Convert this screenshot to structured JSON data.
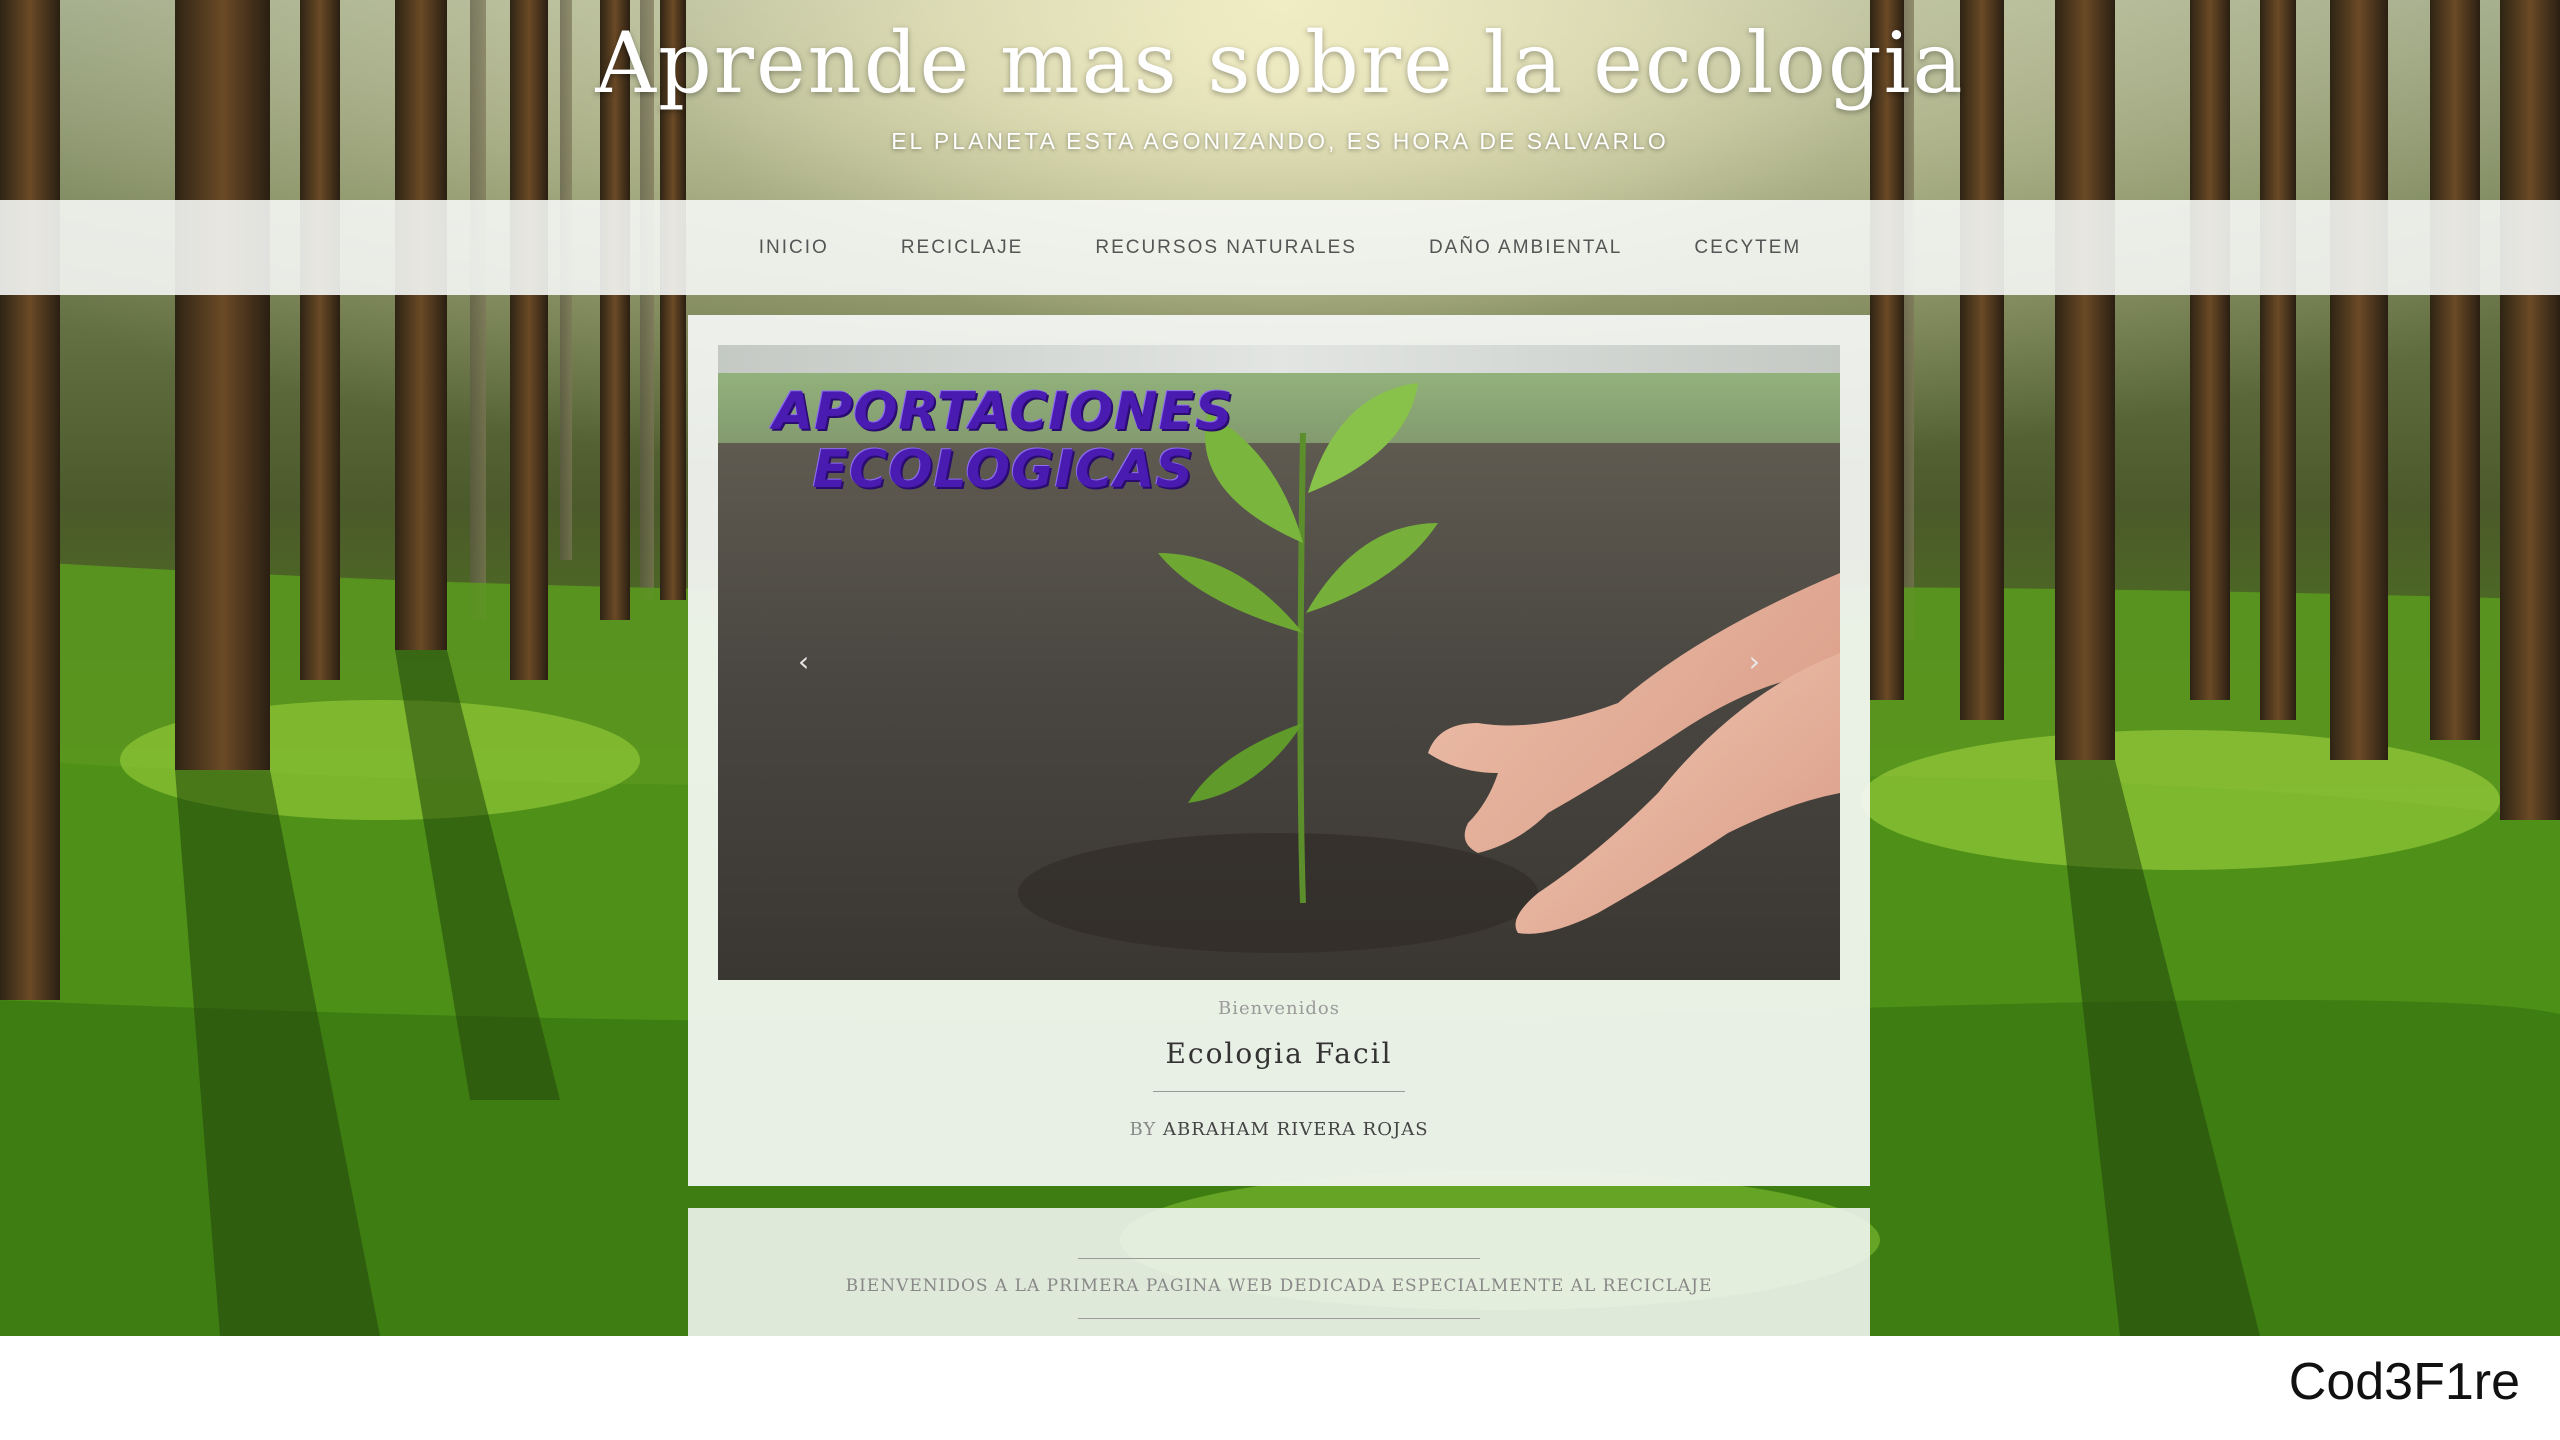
{
  "header": {
    "title": "Aprende mas sobre la ecologia",
    "tagline": "EL PLANETA ESTA AGONIZANDO, ES HORA DE SALVARLO"
  },
  "nav": {
    "items": [
      "INICIO",
      "RECICLAJE",
      "RECURSOS NATURALES",
      "DAÑO AMBIENTAL",
      "CECYTEM"
    ]
  },
  "slider": {
    "image_text_line1": "APORTACIONES",
    "image_text_line2": "ECOLOGICAS",
    "prev_symbol": "‹",
    "next_symbol": "›"
  },
  "post": {
    "category": "Bienvenidos",
    "title": "Ecologia Facil",
    "by_label": "BY",
    "author": "ABRAHAM RIVERA ROJAS"
  },
  "widget": {
    "text": "BIENVENIDOS A LA PRIMERA PAGINA WEB DEDICADA ESPECIALMENTE AL RECICLAJE"
  },
  "watermark": "Cod3F1re",
  "colors": {
    "title_text": "#ffffff",
    "nav_background": "#f5f7f5",
    "slide_text": "#4a1bb0"
  }
}
